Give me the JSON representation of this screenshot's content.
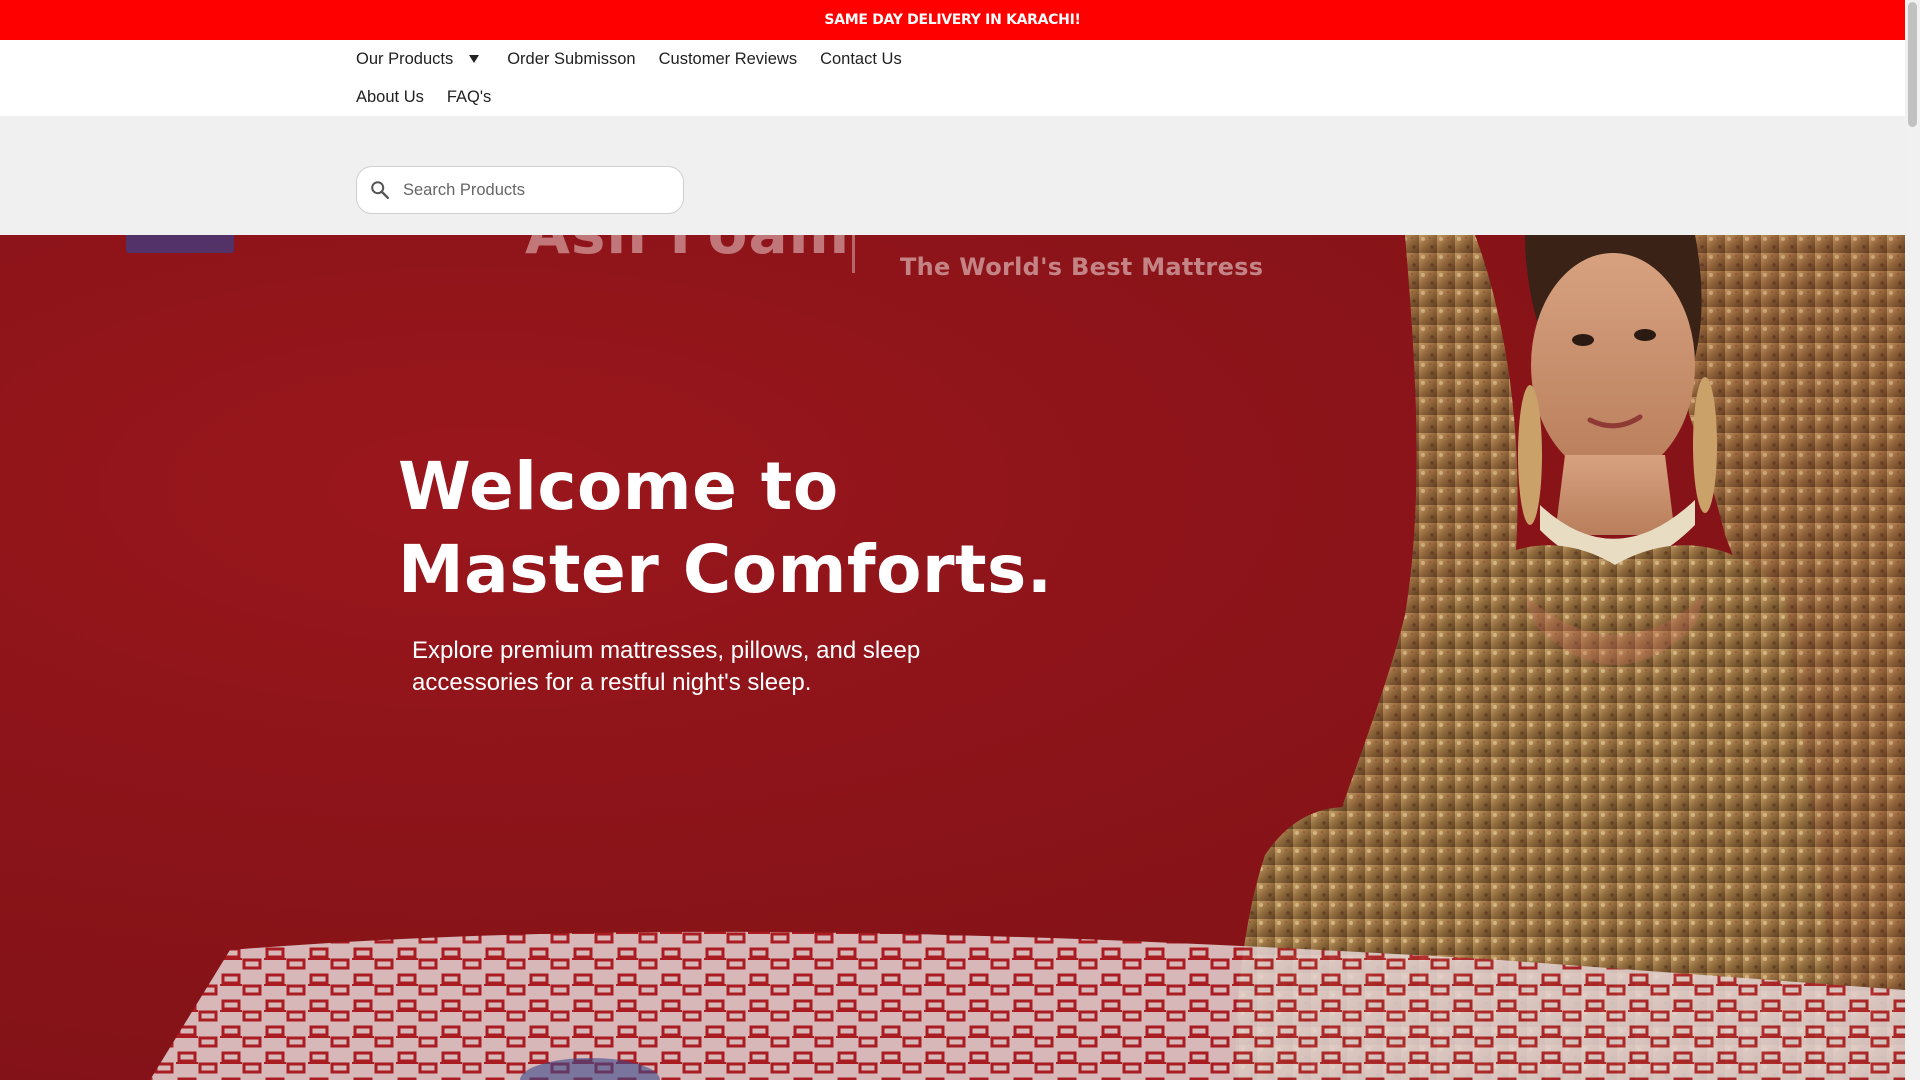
{
  "announcement": {
    "text": "SAME DAY DELIVERY  IN KARACHI!"
  },
  "nav": {
    "items_row1": [
      {
        "label": "Our Products",
        "has_dropdown": true
      },
      {
        "label": "Order Submisson"
      },
      {
        "label": "Customer Reviews"
      },
      {
        "label": "Contact Us"
      }
    ],
    "items_row2": [
      {
        "label": "About Us"
      },
      {
        "label": "FAQ's"
      }
    ]
  },
  "search": {
    "placeholder": "Search Products",
    "value": "",
    "icon": "search-icon"
  },
  "hero": {
    "banner_brand_text": "Asli Foam",
    "banner_tagline": "The World's Best Mattress",
    "title": "Welcome to Master Comforts.",
    "subtitle": "Explore premium mattresses, pillows, and sleep accessories for a restful night's sleep.",
    "background_color": "#8b1218"
  },
  "colors": {
    "announcement_bg": "#ff0000",
    "search_band_bg": "#f0f0f0",
    "nav_text": "#222222"
  }
}
